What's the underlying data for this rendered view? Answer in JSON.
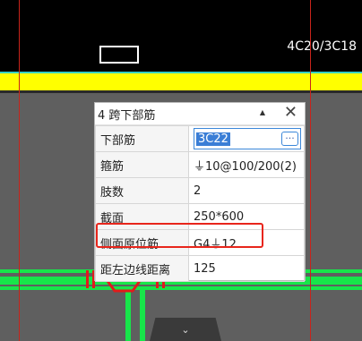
{
  "canvas": {
    "top_right_label": "4C20/3C18",
    "bottom_tab_icon": "chevron-down-icon"
  },
  "panel": {
    "title": "4 跨下部筋",
    "pin_icon": "pin-icon",
    "close_icon": "close-icon",
    "rows": [
      {
        "key": "下部筋",
        "value": "3C22"
      },
      {
        "key": "箍筋",
        "value": "⏚10@100/200(2)"
      },
      {
        "key": "肢数",
        "value": "2"
      },
      {
        "key": "截面",
        "value": "250*600"
      },
      {
        "key": "侧面原位筋",
        "value": "G4⏚12"
      },
      {
        "key": "距左边线距离",
        "value": "125"
      }
    ]
  },
  "colors": {
    "highlight": "#e8251b",
    "beam": "#17e64a",
    "axis": "#c8231b",
    "band": "#ffff00"
  }
}
